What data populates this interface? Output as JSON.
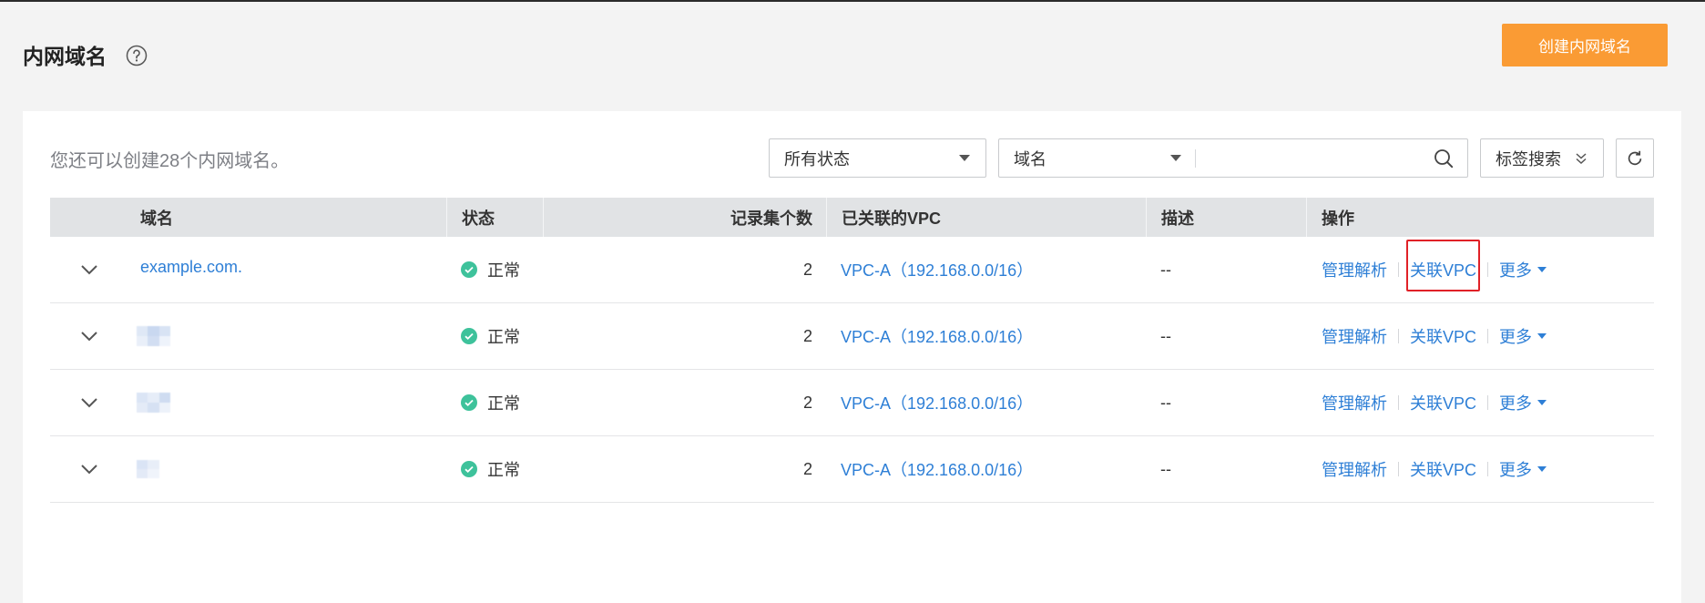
{
  "page": {
    "title": "内网域名",
    "help_icon": "question-circle-icon"
  },
  "toolbar": {
    "create_label": "创建内网域名"
  },
  "quota_text": "您还可以创建28个内网域名。",
  "filters": {
    "status_select": {
      "value": "所有状态",
      "icon": "caret-down-icon"
    },
    "search_field_select": {
      "value": "域名",
      "icon": "caret-down-icon"
    },
    "search_input": {
      "value": "",
      "icon": "search-icon"
    },
    "tag_search": {
      "label": "标签搜索",
      "icon": "double-chevron-down-icon"
    },
    "refresh": {
      "icon": "refresh-icon"
    }
  },
  "table": {
    "columns": [
      "域名",
      "状态",
      "记录集个数",
      "已关联的VPC",
      "描述",
      "操作"
    ],
    "rows": [
      {
        "domain": "example.com.",
        "status": "正常",
        "record_count": 2,
        "vpc": "VPC-A（192.168.0.0/16）",
        "description": "--",
        "actions": [
          "管理解析",
          "关联VPC",
          "更多"
        ]
      },
      {
        "status": "正常",
        "record_count": 2,
        "vpc": "VPC-A（192.168.0.0/16）",
        "description": "--",
        "actions": [
          "管理解析",
          "关联VPC",
          "更多"
        ]
      },
      {
        "status": "正常",
        "record_count": 2,
        "vpc": "VPC-A（192.168.0.0/16）",
        "description": "--",
        "actions": [
          "管理解析",
          "关联VPC",
          "更多"
        ]
      },
      {
        "status": "正常",
        "record_count": 2,
        "vpc": "VPC-A（192.168.0.0/16）",
        "description": "--",
        "actions": [
          "管理解析",
          "关联VPC",
          "更多"
        ]
      }
    ]
  },
  "colors": {
    "accent": "#fa9b34",
    "link": "#2e7fd6",
    "success": "#3ec29b",
    "highlight": "#e02127"
  }
}
